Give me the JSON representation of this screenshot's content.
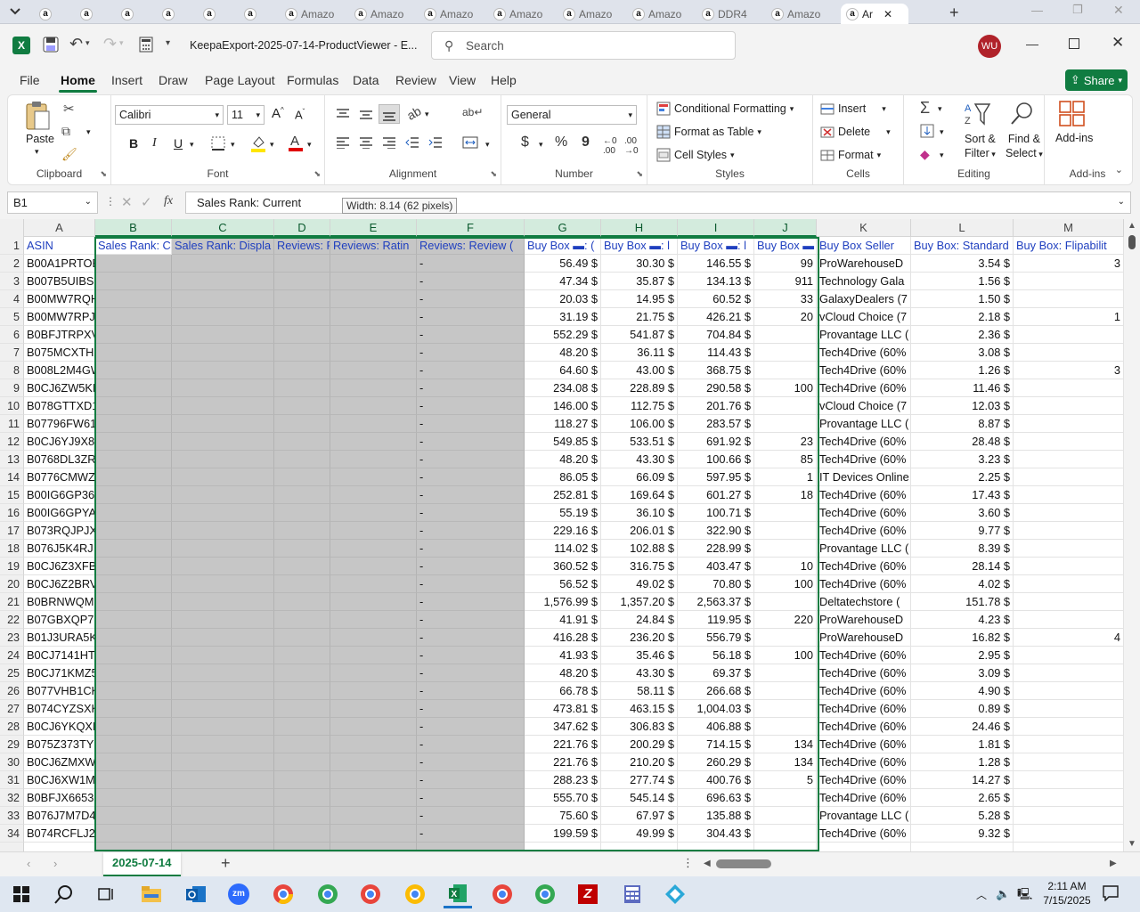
{
  "browser_tabs": [
    {
      "label": "a",
      "active": false
    },
    {
      "label": "a",
      "active": false
    },
    {
      "label": "a",
      "active": false
    },
    {
      "label": "a",
      "active": false
    },
    {
      "label": "a",
      "active": false
    },
    {
      "label": "a",
      "active": false
    },
    {
      "label": "Amazo",
      "active": false
    },
    {
      "label": "Amazo",
      "active": false
    },
    {
      "label": "Amazo",
      "active": false
    },
    {
      "label": "Amazo",
      "active": false
    },
    {
      "label": "Amazo",
      "active": false
    },
    {
      "label": "Amazo",
      "active": false
    },
    {
      "label": "DDR4",
      "active": false
    },
    {
      "label": "Amazo",
      "active": false
    },
    {
      "label": "Ar",
      "active": true
    }
  ],
  "titlebar": {
    "filename": "KeepaExport-2025-07-14-ProductViewer  -  E...",
    "search_placeholder": "Search",
    "user_initials": "WU"
  },
  "menu_tabs": [
    "File",
    "Home",
    "Insert",
    "Draw",
    "Page Layout",
    "Formulas",
    "Data",
    "Review",
    "View",
    "Help"
  ],
  "share_label": "Share",
  "ribbon": {
    "clipboard": {
      "paste": "Paste",
      "label": "Clipboard"
    },
    "font": {
      "name": "Calibri",
      "size": "11",
      "label": "Font",
      "bold": "B",
      "italic": "I",
      "underline": "U"
    },
    "alignment": {
      "label": "Alignment"
    },
    "number": {
      "format": "General",
      "label": "Number",
      "currency": "$",
      "percent": "%",
      "comma": "9"
    },
    "styles": {
      "conditional": "Conditional Formatting",
      "format_table": "Format as Table",
      "cell_styles": "Cell Styles",
      "label": "Styles"
    },
    "cells": {
      "insert": "Insert",
      "delete": "Delete",
      "format": "Format",
      "label": "Cells"
    },
    "editing": {
      "sort_filter_1": "Sort &",
      "sort_filter_2": "Filter",
      "find_select_1": "Find &",
      "find_select_2": "Select",
      "label": "Editing"
    },
    "addins": {
      "button": "Add-ins",
      "label": "Add-ins"
    }
  },
  "formula_bar": {
    "name_box": "B1",
    "fx": "fx",
    "formula": "Sales Rank: Current",
    "tooltip": "Width: 8.14 (62 pixels)"
  },
  "columns": [
    "A",
    "B",
    "C",
    "D",
    "E",
    "F",
    "G",
    "H",
    "I",
    "J",
    "K",
    "L",
    "M"
  ],
  "header_row": [
    "ASIN",
    "Sales Rank: Cu",
    "Sales Rank: Displa",
    "Reviews: R",
    "Reviews: Ratin",
    "Reviews: Review (",
    "Buy Box ▬: (",
    "Buy Box ▬: l",
    "Buy Box ▬: l",
    "Buy Box ▬",
    "Buy Box Seller",
    "Buy Box: Standard",
    "Buy Box: Flipabilit"
  ],
  "rows": [
    {
      "n": "2",
      "a": "B00A1PRTOE",
      "f": "-",
      "g": "56.49 $",
      "h": "30.30 $",
      "i": "146.55 $",
      "j": "99",
      "k": "ProWarehouseD",
      "l": "3.54 $",
      "m": "3"
    },
    {
      "n": "3",
      "a": "B007B5UIBS",
      "f": "-",
      "g": "47.34 $",
      "h": "35.87 $",
      "i": "134.13 $",
      "j": "911",
      "k": "Technology Gala",
      "l": "1.56 $",
      "m": ""
    },
    {
      "n": "4",
      "a": "B00MW7RQHY",
      "f": "-",
      "g": "20.03 $",
      "h": "14.95 $",
      "i": "60.52 $",
      "j": "33",
      "k": "GalaxyDealers (7",
      "l": "1.50 $",
      "m": ""
    },
    {
      "n": "5",
      "a": "B00MW7RPJ8",
      "f": "-",
      "g": "31.19 $",
      "h": "21.75 $",
      "i": "426.21 $",
      "j": "20",
      "k": "vCloud Choice (7",
      "l": "2.18 $",
      "m": "1"
    },
    {
      "n": "6",
      "a": "B0BFJTRPXV",
      "f": "-",
      "g": "552.29 $",
      "h": "541.87 $",
      "i": "704.84 $",
      "j": "",
      "k": "Provantage LLC (",
      "l": "2.36 $",
      "m": ""
    },
    {
      "n": "7",
      "a": "B075MCXTHX",
      "f": "-",
      "g": "48.20 $",
      "h": "36.11 $",
      "i": "114.43 $",
      "j": "",
      "k": "Tech4Drive (60%",
      "l": "3.08 $",
      "m": ""
    },
    {
      "n": "8",
      "a": "B008L2M4GW",
      "f": "-",
      "g": "64.60 $",
      "h": "43.00 $",
      "i": "368.75 $",
      "j": "",
      "k": "Tech4Drive (60%",
      "l": "1.26 $",
      "m": "3"
    },
    {
      "n": "9",
      "a": "B0CJ6ZW5KF",
      "f": "-",
      "g": "234.08 $",
      "h": "228.89 $",
      "i": "290.58 $",
      "j": "100",
      "k": "Tech4Drive (60%",
      "l": "11.46 $",
      "m": ""
    },
    {
      "n": "10",
      "a": "B078GTTXD1",
      "f": "-",
      "g": "146.00 $",
      "h": "112.75 $",
      "i": "201.76 $",
      "j": "",
      "k": "vCloud Choice (7",
      "l": "12.03 $",
      "m": ""
    },
    {
      "n": "11",
      "a": "B07796FW61",
      "f": "-",
      "g": "118.27 $",
      "h": "106.00 $",
      "i": "283.57 $",
      "j": "",
      "k": "Provantage LLC (",
      "l": "8.87 $",
      "m": ""
    },
    {
      "n": "12",
      "a": "B0CJ6YJ9X8",
      "f": "-",
      "g": "549.85 $",
      "h": "533.51 $",
      "i": "691.92 $",
      "j": "23",
      "k": "Tech4Drive (60%",
      "l": "28.48 $",
      "m": ""
    },
    {
      "n": "13",
      "a": "B0768DL3ZR",
      "f": "-",
      "g": "48.20 $",
      "h": "43.30 $",
      "i": "100.66 $",
      "j": "85",
      "k": "Tech4Drive (60%",
      "l": "3.23 $",
      "m": ""
    },
    {
      "n": "14",
      "a": "B0776CMWZQ",
      "f": "-",
      "g": "86.05 $",
      "h": "66.09 $",
      "i": "597.95 $",
      "j": "1",
      "k": "IT Devices Online",
      "l": "2.25 $",
      "m": ""
    },
    {
      "n": "15",
      "a": "B00IG6GP36",
      "f": "-",
      "g": "252.81 $",
      "h": "169.64 $",
      "i": "601.27 $",
      "j": "18",
      "k": "Tech4Drive (60%",
      "l": "17.43 $",
      "m": ""
    },
    {
      "n": "16",
      "a": "B00IG6GPYA",
      "f": "-",
      "g": "55.19 $",
      "h": "36.10 $",
      "i": "100.71 $",
      "j": "",
      "k": "Tech4Drive (60%",
      "l": "3.60 $",
      "m": ""
    },
    {
      "n": "17",
      "a": "B073RQJPJX",
      "f": "-",
      "g": "229.16 $",
      "h": "206.01 $",
      "i": "322.90 $",
      "j": "",
      "k": "Tech4Drive (60%",
      "l": "9.77 $",
      "m": ""
    },
    {
      "n": "18",
      "a": "B076J5K4RJ",
      "f": "-",
      "g": "114.02 $",
      "h": "102.88 $",
      "i": "228.99 $",
      "j": "",
      "k": "Provantage LLC (",
      "l": "8.39 $",
      "m": ""
    },
    {
      "n": "19",
      "a": "B0CJ6Z3XFB",
      "f": "-",
      "g": "360.52 $",
      "h": "316.75 $",
      "i": "403.47 $",
      "j": "10",
      "k": "Tech4Drive (60%",
      "l": "28.14 $",
      "m": ""
    },
    {
      "n": "20",
      "a": "B0CJ6Z2BRV",
      "f": "-",
      "g": "56.52 $",
      "h": "49.02 $",
      "i": "70.80 $",
      "j": "100",
      "k": "Tech4Drive (60%",
      "l": "4.02 $",
      "m": ""
    },
    {
      "n": "21",
      "a": "B0BRNWQMBW",
      "f": "-",
      "g": "1,576.99 $",
      "h": "1,357.20 $",
      "i": "2,563.37 $",
      "j": "",
      "k": "Deltatechstore (",
      "l": "151.78 $",
      "m": ""
    },
    {
      "n": "22",
      "a": "B07GBXQP7C",
      "f": "-",
      "g": "41.91 $",
      "h": "24.84 $",
      "i": "119.95 $",
      "j": "220",
      "k": "ProWarehouseD",
      "l": "4.23 $",
      "m": ""
    },
    {
      "n": "23",
      "a": "B01J3URA5K",
      "f": "-",
      "g": "416.28 $",
      "h": "236.20 $",
      "i": "556.79 $",
      "j": "",
      "k": "ProWarehouseD",
      "l": "16.82 $",
      "m": "4"
    },
    {
      "n": "24",
      "a": "B0CJ7141HT",
      "f": "-",
      "g": "41.93 $",
      "h": "35.46 $",
      "i": "56.18 $",
      "j": "100",
      "k": "Tech4Drive (60%",
      "l": "2.95 $",
      "m": ""
    },
    {
      "n": "25",
      "a": "B0CJ71KMZ5",
      "f": "-",
      "g": "48.20 $",
      "h": "43.30 $",
      "i": "69.37 $",
      "j": "",
      "k": "Tech4Drive (60%",
      "l": "3.09 $",
      "m": ""
    },
    {
      "n": "26",
      "a": "B077VHB1CK",
      "f": "-",
      "g": "66.78 $",
      "h": "58.11 $",
      "i": "266.68 $",
      "j": "",
      "k": "Tech4Drive (60%",
      "l": "4.90 $",
      "m": ""
    },
    {
      "n": "27",
      "a": "B074CYZSXK",
      "f": "-",
      "g": "473.81 $",
      "h": "463.15 $",
      "i": "1,004.03 $",
      "j": "",
      "k": "Tech4Drive (60%",
      "l": "0.89 $",
      "m": ""
    },
    {
      "n": "28",
      "a": "B0CJ6YKQXH",
      "f": "-",
      "g": "347.62 $",
      "h": "306.83 $",
      "i": "406.88 $",
      "j": "",
      "k": "Tech4Drive (60%",
      "l": "24.46 $",
      "m": ""
    },
    {
      "n": "29",
      "a": "B075Z373TY",
      "f": "-",
      "g": "221.76 $",
      "h": "200.29 $",
      "i": "714.15 $",
      "j": "134",
      "k": "Tech4Drive (60%",
      "l": "1.81 $",
      "m": ""
    },
    {
      "n": "30",
      "a": "B0CJ6ZMXWN",
      "f": "-",
      "g": "221.76 $",
      "h": "210.20 $",
      "i": "260.29 $",
      "j": "134",
      "k": "Tech4Drive (60%",
      "l": "1.28 $",
      "m": ""
    },
    {
      "n": "31",
      "a": "B0CJ6XW1MQ",
      "f": "-",
      "g": "288.23 $",
      "h": "277.74 $",
      "i": "400.76 $",
      "j": "5",
      "k": "Tech4Drive (60%",
      "l": "14.27 $",
      "m": ""
    },
    {
      "n": "32",
      "a": "B0BFJX6653",
      "f": "-",
      "g": "555.70 $",
      "h": "545.14 $",
      "i": "696.63 $",
      "j": "",
      "k": "Tech4Drive (60%",
      "l": "2.65 $",
      "m": ""
    },
    {
      "n": "33",
      "a": "B076J7M7D4",
      "f": "-",
      "g": "75.60 $",
      "h": "67.97 $",
      "i": "135.88 $",
      "j": "",
      "k": "Provantage LLC (",
      "l": "5.28 $",
      "m": ""
    },
    {
      "n": "34",
      "a": "B074RCFLJ2",
      "f": "-",
      "g": "199.59 $",
      "h": "49.99 $",
      "i": "304.43 $",
      "j": "",
      "k": "Tech4Drive (60%",
      "l": "9.32 $",
      "m": ""
    }
  ],
  "sheet_tab": "2025-07-14",
  "clock": {
    "time": "2:11 AM",
    "date": "7/15/2025"
  },
  "colors": {
    "excel_green": "#107c41",
    "selection_gray": "#c6c6c6",
    "header_blue": "#1f3fbf",
    "share_green": "#107c41"
  }
}
